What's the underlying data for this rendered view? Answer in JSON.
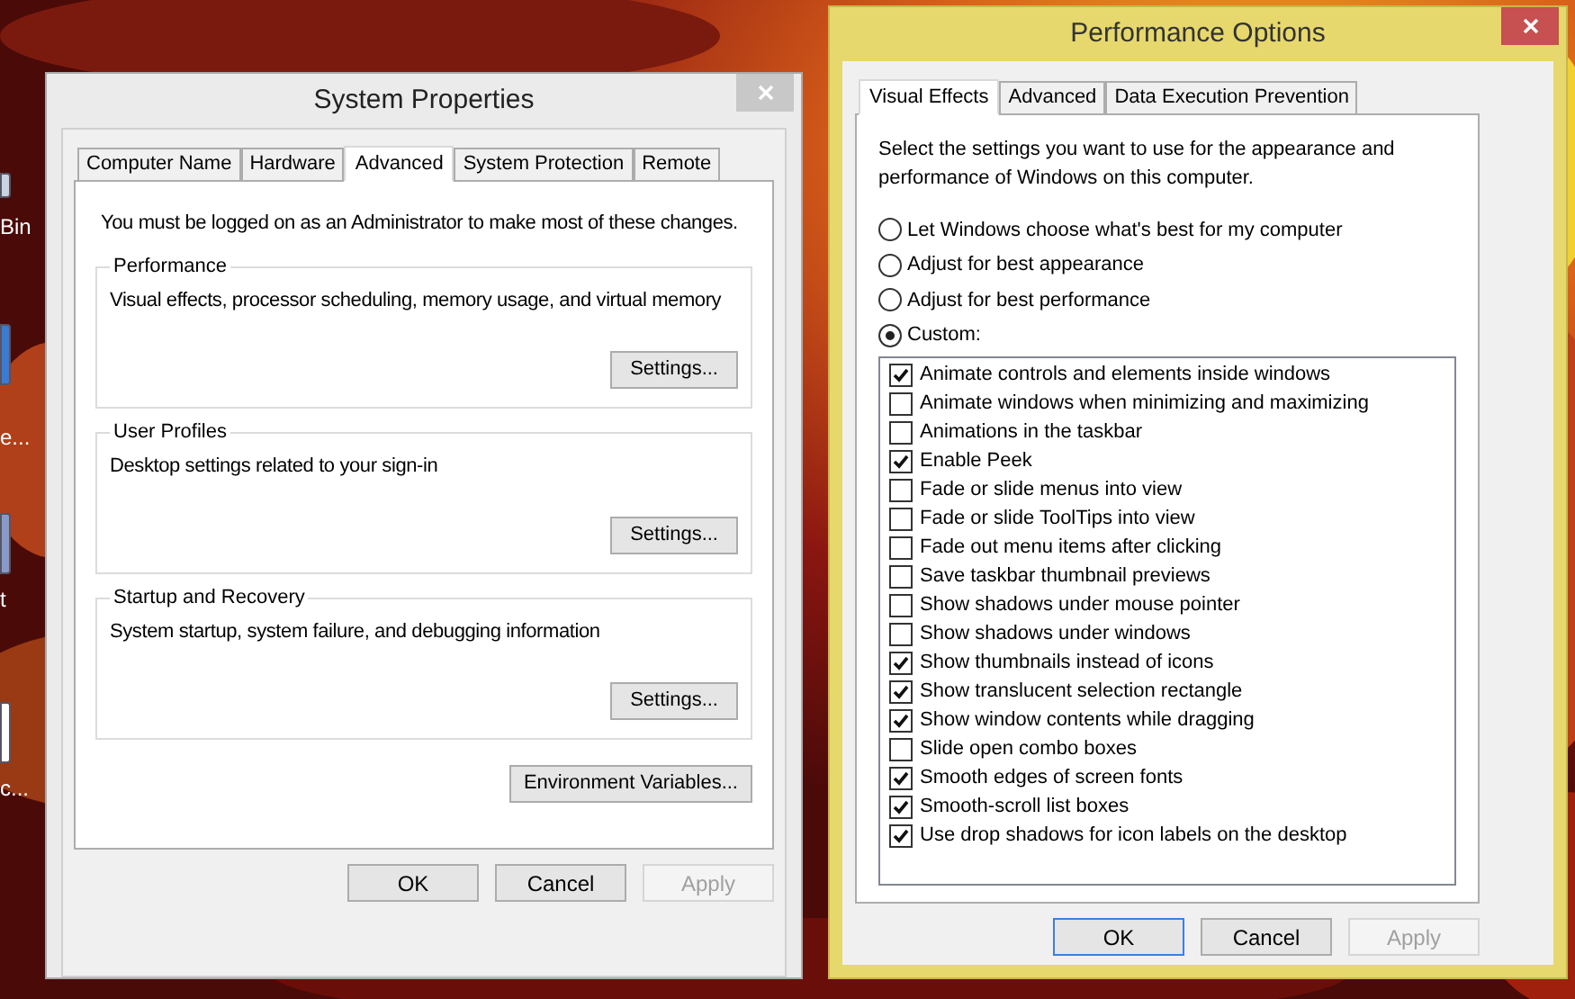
{
  "desktop": {
    "icons": [
      {
        "label": "Bin"
      },
      {
        "label": "e..."
      },
      {
        "label": "t"
      },
      {
        "label": "c..."
      }
    ]
  },
  "system_properties": {
    "title": "System Properties",
    "active": false,
    "tabs": [
      {
        "label": "Computer Name",
        "selected": false
      },
      {
        "label": "Hardware",
        "selected": false
      },
      {
        "label": "Advanced",
        "selected": true
      },
      {
        "label": "System Protection",
        "selected": false
      },
      {
        "label": "Remote",
        "selected": false
      }
    ],
    "admin_note": "You must be logged on as an Administrator to make most of these changes.",
    "groups": [
      {
        "title": "Performance",
        "description": "Visual effects, processor scheduling, memory usage, and virtual memory",
        "button": "Settings..."
      },
      {
        "title": "User Profiles",
        "description": "Desktop settings related to your sign-in",
        "button": "Settings..."
      },
      {
        "title": "Startup and Recovery",
        "description": "System startup, system failure, and debugging information",
        "button": "Settings..."
      }
    ],
    "environment_button": "Environment Variables...",
    "buttons": [
      {
        "label": "OK",
        "disabled": false,
        "default": false
      },
      {
        "label": "Cancel",
        "disabled": false,
        "default": false
      },
      {
        "label": "Apply",
        "disabled": true,
        "default": false
      }
    ]
  },
  "performance_options": {
    "title": "Performance Options",
    "active": true,
    "tabs": [
      {
        "label": "Visual Effects",
        "selected": true
      },
      {
        "label": "Advanced",
        "selected": false
      },
      {
        "label": "Data Execution Prevention",
        "selected": false
      }
    ],
    "description": "Select the settings you want to use for the appearance and performance of Windows on this computer.",
    "options": [
      {
        "label": "Let Windows choose what's best for my computer",
        "selected": false
      },
      {
        "label": "Adjust for best appearance",
        "selected": false
      },
      {
        "label": "Adjust for best performance",
        "selected": false
      },
      {
        "label": "Custom:",
        "selected": true
      }
    ],
    "effects": [
      {
        "label": "Animate controls and elements inside windows",
        "checked": true
      },
      {
        "label": "Animate windows when minimizing and maximizing",
        "checked": false
      },
      {
        "label": "Animations in the taskbar",
        "checked": false
      },
      {
        "label": "Enable Peek",
        "checked": true
      },
      {
        "label": "Fade or slide menus into view",
        "checked": false
      },
      {
        "label": "Fade or slide ToolTips into view",
        "checked": false
      },
      {
        "label": "Fade out menu items after clicking",
        "checked": false
      },
      {
        "label": "Save taskbar thumbnail previews",
        "checked": false
      },
      {
        "label": "Show shadows under mouse pointer",
        "checked": false
      },
      {
        "label": "Show shadows under windows",
        "checked": false
      },
      {
        "label": "Show thumbnails instead of icons",
        "checked": true
      },
      {
        "label": "Show translucent selection rectangle",
        "checked": true
      },
      {
        "label": "Show window contents while dragging",
        "checked": true
      },
      {
        "label": "Slide open combo boxes",
        "checked": false
      },
      {
        "label": "Smooth edges of screen fonts",
        "checked": true
      },
      {
        "label": "Smooth-scroll list boxes",
        "checked": true
      },
      {
        "label": "Use drop shadows for icon labels on the desktop",
        "checked": true
      }
    ],
    "buttons": [
      {
        "label": "OK",
        "disabled": false,
        "default": true
      },
      {
        "label": "Cancel",
        "disabled": false,
        "default": false
      },
      {
        "label": "Apply",
        "disabled": true,
        "default": false
      }
    ]
  }
}
